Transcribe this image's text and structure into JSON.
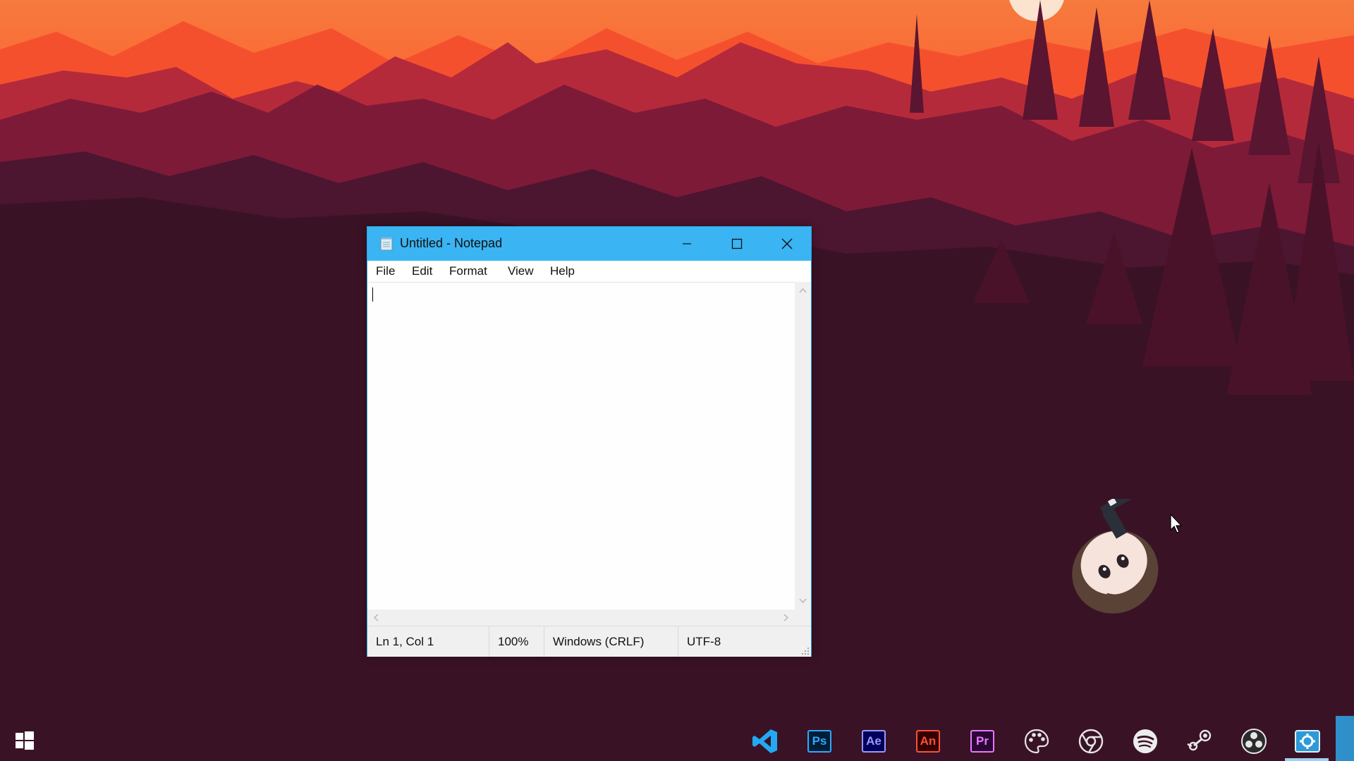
{
  "window": {
    "title": "Untitled - Notepad",
    "menu": [
      "File",
      "Edit",
      "Format",
      "View",
      "Help"
    ],
    "status": {
      "position": "Ln 1, Col 1",
      "zoom": "100%",
      "line_ending": "Windows (CRLF)",
      "encoding": "UTF-8"
    }
  },
  "taskbar": {
    "apps": [
      {
        "name": "vscode-icon"
      },
      {
        "name": "photoshop-icon",
        "label": "Ps",
        "color": "#31a8ff",
        "bg": "#001e36"
      },
      {
        "name": "after-effects-icon",
        "label": "Ae",
        "color": "#9999ff",
        "bg": "#00005b"
      },
      {
        "name": "animate-icon",
        "label": "An",
        "color": "#ff4f3a",
        "bg": "#330000"
      },
      {
        "name": "premiere-icon",
        "label": "Pr",
        "color": "#ea77ff",
        "bg": "#2a0634"
      },
      {
        "name": "palette-icon"
      },
      {
        "name": "chrome-icon"
      },
      {
        "name": "spotify-icon"
      },
      {
        "name": "steam-icon"
      },
      {
        "name": "obs-icon"
      },
      {
        "name": "settings-app-icon"
      }
    ]
  },
  "colors": {
    "titlebar": "#3ab4f2",
    "sky": "#ff6a35",
    "accent": "#2aa3e3"
  }
}
